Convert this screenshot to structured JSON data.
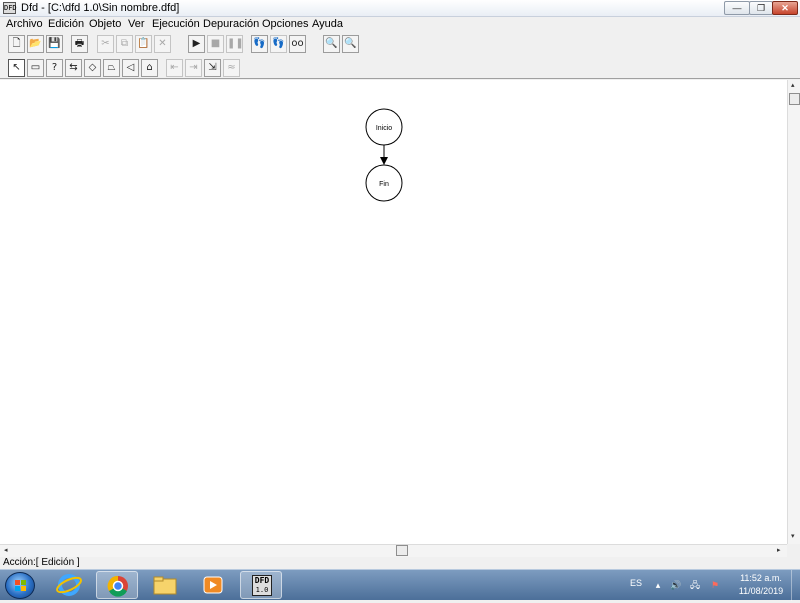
{
  "window": {
    "title": "Dfd - [C:\\dfd 1.0\\Sin nombre.dfd]",
    "app_icon_text": "DFD"
  },
  "window_controls": {
    "minimize": "—",
    "maximize": "❐",
    "close": "✕"
  },
  "menu": [
    "Archivo",
    "Edición",
    "Objeto",
    "Ver",
    "Ejecución",
    "Depuración",
    "Opciones",
    "Ayuda"
  ],
  "toolbar1": {
    "new": "🗋",
    "open": "📂",
    "save": "💾",
    "print": "🖶",
    "cut": "✂",
    "copy": "⧉",
    "paste": "📋",
    "delete": "✕",
    "run": "▶",
    "stop": "■",
    "pause": "❚❚",
    "step": "👣",
    "step_out": "👣",
    "watch": "oo",
    "zoom_out": "🔍",
    "zoom_in": "🔍"
  },
  "toolbar2": {
    "pointer": "↖",
    "assign": "▭",
    "read": "?",
    "write": "⇆",
    "decision": "◇",
    "loop_for": "⏢",
    "loop_while": "◁",
    "subprogram": "⌂",
    "insert_before": "⇤",
    "insert_after": "⇥",
    "insert_out": "⇲",
    "remove": "≈"
  },
  "flowchart": {
    "nodes": [
      {
        "id": "start",
        "label": "Inicio"
      },
      {
        "id": "end",
        "label": "Fin"
      }
    ]
  },
  "scrollbars": {
    "left_arrow": "◂",
    "right_arrow": "▸",
    "up_arrow": "▴",
    "down_arrow": "▾"
  },
  "status": {
    "text": "Acción:[ Edición ]"
  },
  "taskbar": {
    "lang": "ES",
    "time": "11:52 a.m.",
    "date": "11/08/2019",
    "tasks": [
      "Internet Explorer",
      "Google Chrome",
      "Explorador de archivos",
      "Reproductor multimedia",
      "DFD 1.0"
    ],
    "dfd_label_top": "DFD",
    "dfd_label_bottom": "1.0"
  },
  "tray_icons": {
    "up": "▴",
    "volume": "🔊",
    "network": "🖧",
    "flag": "⚑"
  },
  "colors": {
    "title_gradient": "#e9eef5",
    "taskbar": "#4c6f99",
    "close_button": "#c6442c",
    "canvas": "#ffffff"
  }
}
